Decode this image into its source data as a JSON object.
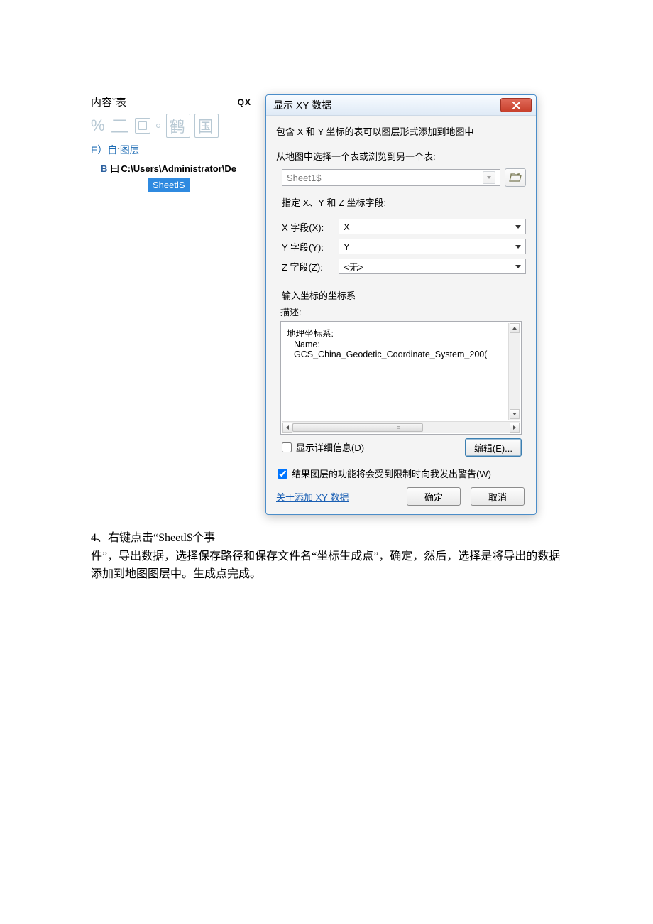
{
  "left": {
    "header": "内容ˇ表",
    "qx": "QX",
    "deco_pct": "%",
    "deco_cn1": "二",
    "deco_cn2": "鹤",
    "deco_cn3": "国",
    "layer_prefix": "E）自",
    "layer_caret": "ˇ",
    "layer_word": "图层",
    "path_b": "B",
    "path_ic": "曰",
    "path_text": "C:\\Users\\Administrator\\De",
    "sheet": "SheetlS"
  },
  "dialog": {
    "title": "显示 XY 数据",
    "intro": "包含 X 和 Y 坐标的表可以图层形式添加到地图中",
    "pick_table": "从地图中选择一个表或浏览到另一个表:",
    "table_value": "Sheet1$",
    "fields_label": "指定 X、Y 和 Z 坐标字段:",
    "x_label": "X 字段(X):",
    "y_label": "Y 字段(Y):",
    "z_label": "Z 字段(Z):",
    "x_value": "X",
    "y_value": "Y",
    "z_value": "<无>",
    "crs_group": "输入坐标的坐标系",
    "desc_label": "描述:",
    "crs_line1": "地理坐标系:",
    "crs_line2": "Name: GCS_China_Geodetic_Coordinate_System_200(",
    "detail_cb": "显示详细信息(D)",
    "edit_btn": "编辑(E)...",
    "warn_cb": "结果图层的功能将会受到限制时向我发出警告(W)",
    "about_link": "关于添加 XY 数据",
    "ok": "确定",
    "cancel": "取消"
  },
  "below": {
    "line1a": "4",
    "line1b": "、右键点击“Sheetl$个事",
    "line2": "件”，导出数据，选择保存路径和保存文件名“坐标生成点”，确定，然后，选择是将导出的数据添加到地图图层中。生成点完成。"
  }
}
